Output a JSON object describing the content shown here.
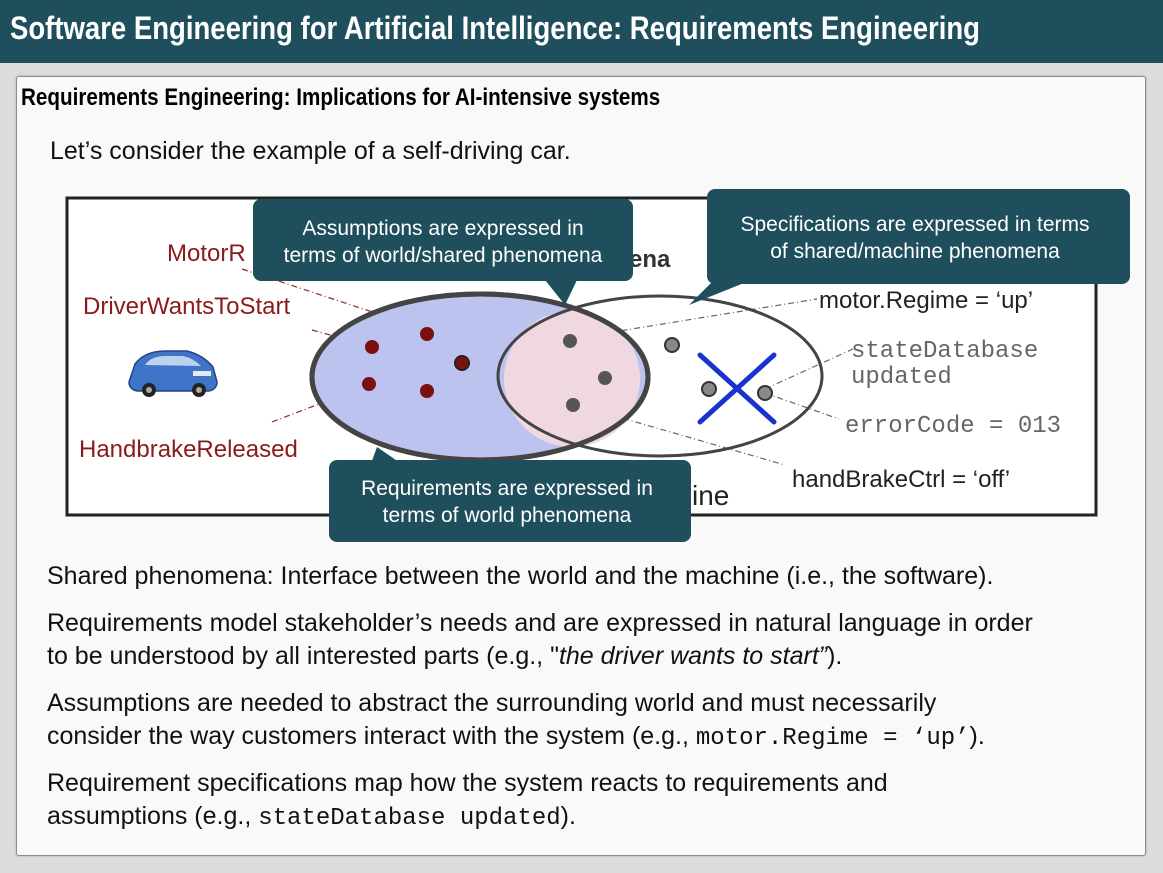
{
  "header": {
    "title": "Software Engineering for Artificial Intelligence: Requirements Engineering"
  },
  "section": {
    "title": "Requirements Engineering: Implications for AI-intensive systems",
    "intro": "Let’s consider the example of a self-driving car."
  },
  "diagram": {
    "world_labels": {
      "motor_regime": "MotorR",
      "driver_wants_to_start": "DriverWantsToStart",
      "handbrake_released": "HandbrakeReleased",
      "phenomena_suffix": "ena",
      "machine_suffix": "ine"
    },
    "machine_labels": {
      "motor_regime_up": "motor.Regime = ‘up’",
      "state_database_line1": "stateDatabase",
      "state_database_line2": "updated",
      "error_code": "errorCode = 013",
      "handbrake_ctrl": "handBrakeCtrl = ‘off’"
    },
    "callouts": {
      "assumptions": [
        "Assumptions are expressed in",
        "terms of world/shared phenomena"
      ],
      "specifications": [
        "Specifications are expressed in terms",
        "of shared/machine phenomena"
      ],
      "requirements": [
        "Requirements are expressed in",
        "terms of world phenomena"
      ]
    },
    "colors": {
      "callout_bg": "#1f4f5c",
      "world_fill": "#bcc3ee",
      "shared_fill": "#efd8df",
      "label_red": "#8b1a1a",
      "cross_blue": "#1a33cc",
      "dot_red": "#7a1010",
      "dot_gray": "#555555"
    },
    "icons": {
      "car": "car-icon",
      "cross": "cross-icon"
    }
  },
  "points": {
    "shared": "Shared phenomena: Interface between the world and the machine (i.e., the software).",
    "requirements_line1": "Requirements model stakeholder’s needs and are expressed in natural language in order",
    "requirements_line2_pre": "to be understood by all interested parts (e.g., \"",
    "requirements_line2_ital": "the driver wants to start”",
    "requirements_line2_post": ").",
    "assumptions_line1": "Assumptions are needed to abstract the surrounding world and must necessarily",
    "assumptions_line2_pre": "consider the way customers interact with the system (e.g., ",
    "assumptions_line2_code": "motor.Regime = ‘up’",
    "assumptions_line2_post": ").",
    "specs_line1": "Requirement specifications map how the system reacts to requirements and",
    "specs_line2_pre": "assumptions (e.g., ",
    "specs_line2_code": "stateDatabase updated",
    "specs_line2_post": ")."
  }
}
